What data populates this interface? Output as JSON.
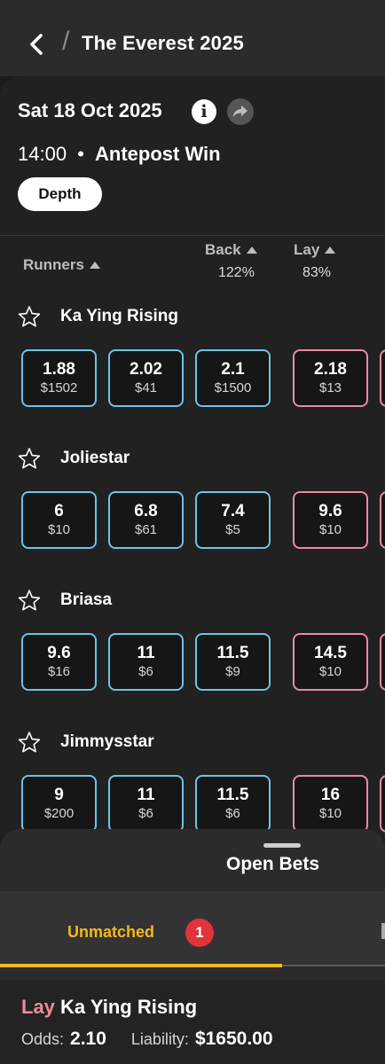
{
  "header": {
    "title": "The Everest 2025",
    "separator": "/"
  },
  "event": {
    "date": "Sat 18 Oct 2025",
    "time": "14:00",
    "dot": "•",
    "market_name": "Antepost Win",
    "depth_label": "Depth"
  },
  "columns": {
    "runners": "Runners",
    "back": "Back",
    "back_pct": "122%",
    "lay": "Lay",
    "lay_pct": "83%"
  },
  "runners": [
    {
      "name": "Ka Ying Rising",
      "back": [
        {
          "price": "1.88",
          "size": "$1502"
        },
        {
          "price": "2.02",
          "size": "$41"
        },
        {
          "price": "2.1",
          "size": "$1500"
        }
      ],
      "lay": [
        {
          "price": "2.18",
          "size": "$13"
        }
      ]
    },
    {
      "name": "Joliestar",
      "back": [
        {
          "price": "6",
          "size": "$10"
        },
        {
          "price": "6.8",
          "size": "$61"
        },
        {
          "price": "7.4",
          "size": "$5"
        }
      ],
      "lay": [
        {
          "price": "9.6",
          "size": "$10"
        }
      ]
    },
    {
      "name": "Briasa",
      "back": [
        {
          "price": "9.6",
          "size": "$16"
        },
        {
          "price": "11",
          "size": "$6"
        },
        {
          "price": "11.5",
          "size": "$9"
        }
      ],
      "lay": [
        {
          "price": "14.5",
          "size": "$10"
        }
      ]
    },
    {
      "name": "Jimmysstar",
      "back": [
        {
          "price": "9",
          "size": "$200"
        },
        {
          "price": "11",
          "size": "$6"
        },
        {
          "price": "11.5",
          "size": "$6"
        }
      ],
      "lay": [
        {
          "price": "16",
          "size": "$10"
        }
      ]
    }
  ],
  "open_bets": {
    "title": "Open Bets",
    "tab_unmatched": "Unmatched",
    "unmatched_count": "1",
    "bet": {
      "side": "Lay",
      "runner": "Ka Ying Rising",
      "odds_label": "Odds:",
      "odds_value": "2.10",
      "liability_label": "Liability:",
      "liability_value": "$1650.00"
    }
  },
  "colors": {
    "back": "#6cc4e6",
    "lay": "#e88ca2",
    "accent": "#f4b81a",
    "badge": "#e0343a"
  }
}
